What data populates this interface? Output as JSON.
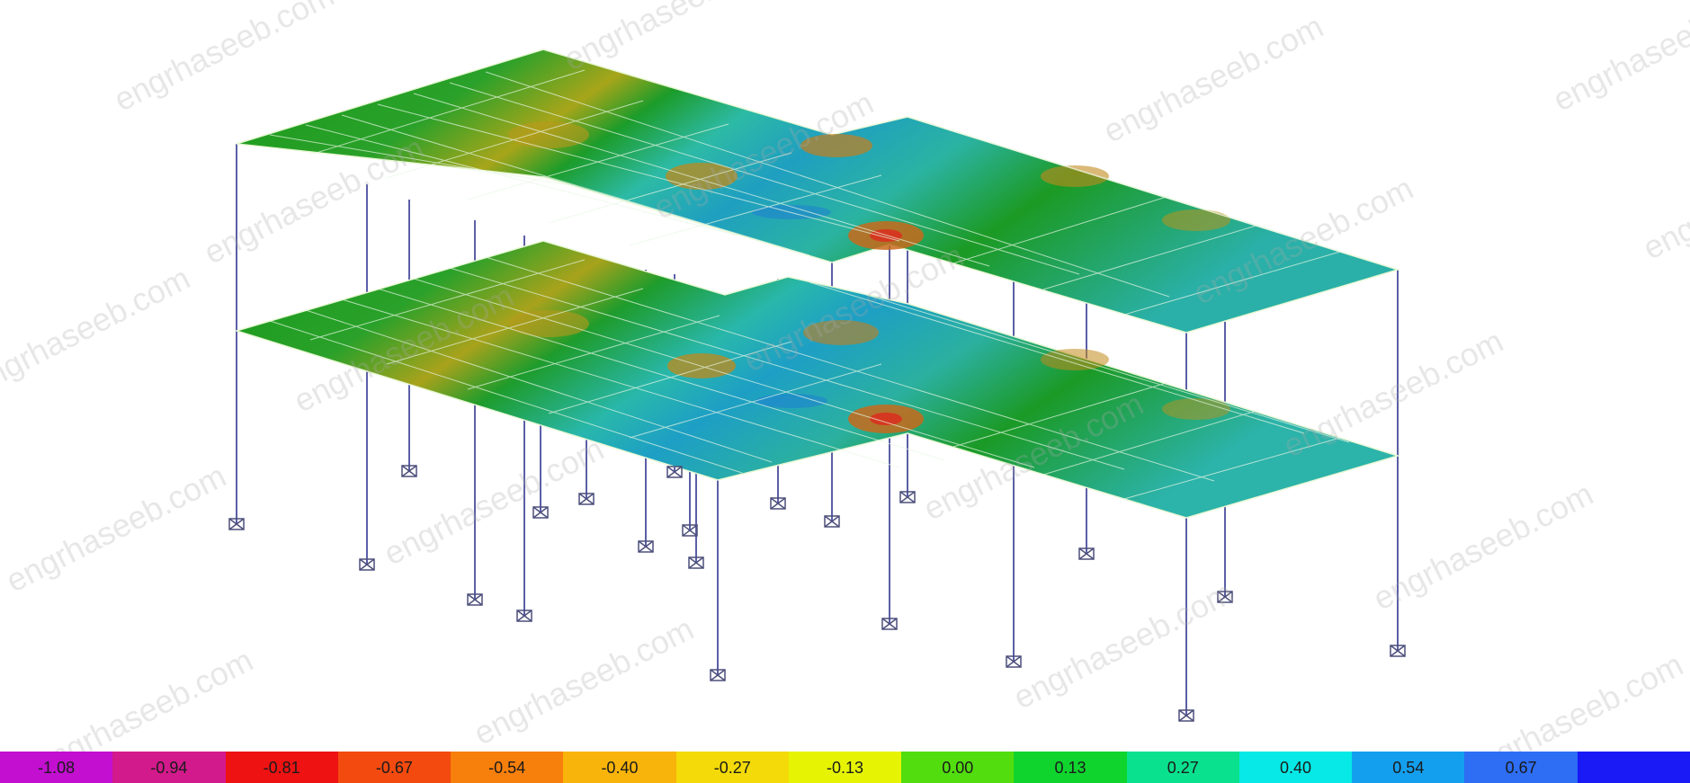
{
  "viewport": {
    "model_name": "3d-frame-model",
    "slab_colors": [
      "#0a8f0a",
      "#1fa01f",
      "#7ea812",
      "#b59a1a",
      "#c6861f",
      "#2bb8a6",
      "#1ab5c2",
      "#3f8ff0",
      "#d43a2a"
    ]
  },
  "legend": {
    "values": [
      "-1.08",
      "-0.94",
      "-0.81",
      "-0.67",
      "-0.54",
      "-0.40",
      "-0.27",
      "-0.13",
      "0.00",
      "0.13",
      "0.27",
      "0.40",
      "0.54",
      "0.67",
      ""
    ],
    "colors": [
      "#c20fd0",
      "#d21a8c",
      "#ee1212",
      "#f34a10",
      "#f77f0c",
      "#f8b40a",
      "#f3da08",
      "#e6f404",
      "#52dd0f",
      "#10d42e",
      "#0ae18e",
      "#06e9e6",
      "#149fee",
      "#2d6ef4",
      "#1a1af7"
    ]
  },
  "watermark": {
    "text": "engrhaseeb.com"
  }
}
